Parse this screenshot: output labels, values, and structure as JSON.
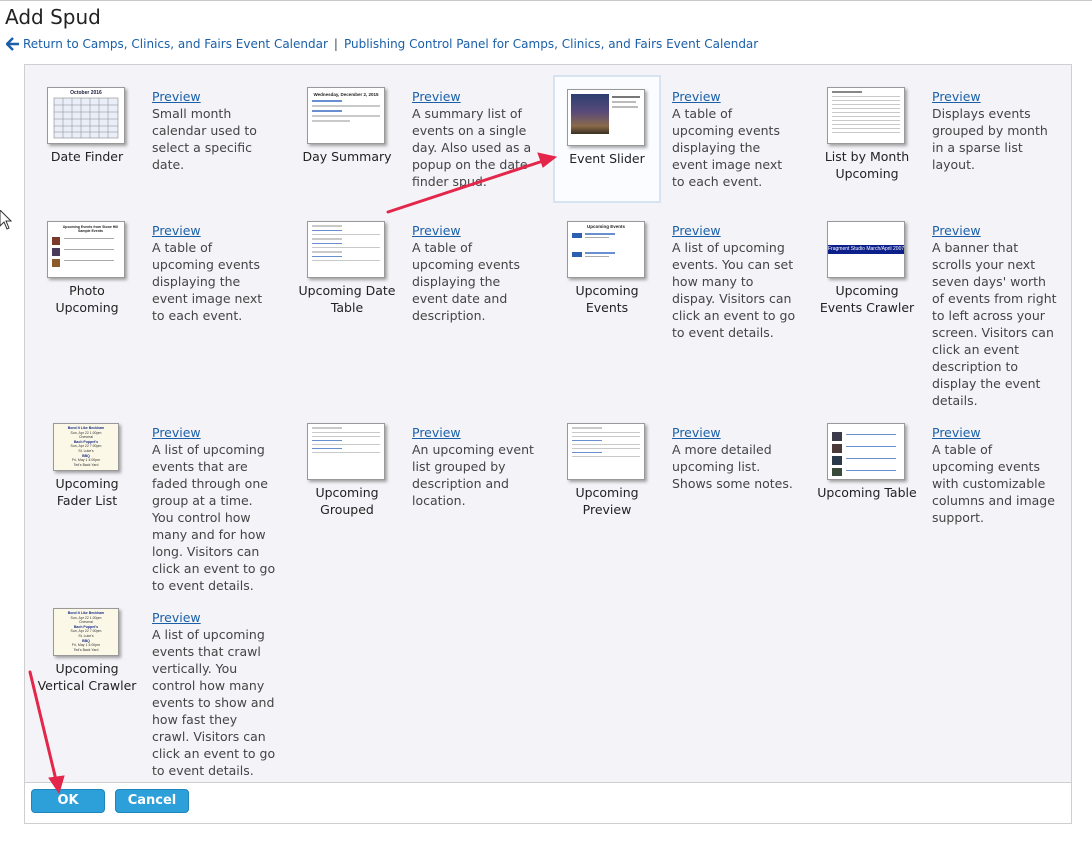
{
  "page": {
    "title": "Add Spud",
    "breadcrumb": {
      "back_link": "Return to Camps, Clinics, and Fairs Event Calendar",
      "separator": "|",
      "panel_link": "Publishing Control Panel for Camps, Clinics, and Fairs Event Calendar"
    }
  },
  "spuds": [
    {
      "label": "Date Finder",
      "preview": "Preview",
      "desc": "Small month calendar used to select a specific date."
    },
    {
      "label": "Day Summary",
      "preview": "Preview",
      "desc": "A summary list of events on a single day. Also used as a popup on the date finder spud."
    },
    {
      "label": "Event Slider",
      "preview": "Preview",
      "desc": "A table of upcoming events displaying the event image next to each event."
    },
    {
      "label": "List by Month Upcoming",
      "preview": "Preview",
      "desc": "Displays events grouped by month in a sparse list layout."
    },
    {
      "label": "Photo Upcoming",
      "preview": "Preview",
      "desc": "A table of upcoming events displaying the event image next to each event."
    },
    {
      "label": "Upcoming Date Table",
      "preview": "Preview",
      "desc": "A table of upcoming events displaying the event date and description."
    },
    {
      "label": "Upcoming Events",
      "preview": "Preview",
      "desc": "A list of upcoming events. You can set how many to dispay. Visitors can click an event to go to event details."
    },
    {
      "label": "Upcoming Events Crawler",
      "preview": "Preview",
      "desc": "A banner that scrolls your next seven days' worth of events from right to left across your screen. Visitors can click an event description to display the event details."
    },
    {
      "label": "Upcoming Fader List",
      "preview": "Preview",
      "desc": "A list of upcoming events that are faded through one group at a time. You control how many and for how long. Visitors can click an event to go to event details."
    },
    {
      "label": "Upcoming Grouped",
      "preview": "Preview",
      "desc": "An upcoming event list grouped by description and location."
    },
    {
      "label": "Upcoming Preview",
      "preview": "Preview",
      "desc": "A more detailed upcoming list. Shows some notes."
    },
    {
      "label": "Upcoming Table",
      "preview": "Preview",
      "desc": "A table of upcoming events with customizable columns and image support."
    },
    {
      "label": "Upcoming Vertical Crawler",
      "preview": "Preview",
      "desc": "A list of upcoming events that crawl vertically. You control how many events to show and how fast they crawl. Visitors can click an event to go to event details."
    }
  ],
  "thumbs": {
    "date_finder_header": "October 2016",
    "day_summary_header": "Wednesday, December 2, 2015",
    "upcoming_events_header": "Upcoming Events",
    "crawler_text": "Fragment Studio March/April 2007 - Sat",
    "photo_header": "Upcoming Events from Stone Hill Sample Events",
    "fader_lines": [
      "Bond It Like Beckham",
      "Sun, Apr 22 1:00pm",
      "Cheveral",
      "Bach Puppet's",
      "Sun, Apr 22 7:00pm",
      "St. Luke's",
      "BBQ",
      "Fri, May 1 4:00pm",
      "Ted's Back Yard"
    ]
  },
  "footer": {
    "ok": "OK",
    "cancel": "Cancel"
  },
  "colors": {
    "link": "#1a5fa8",
    "button": "#2d9fd9",
    "arrow": "#e3264a",
    "panel_bg": "#f4f4f8"
  }
}
